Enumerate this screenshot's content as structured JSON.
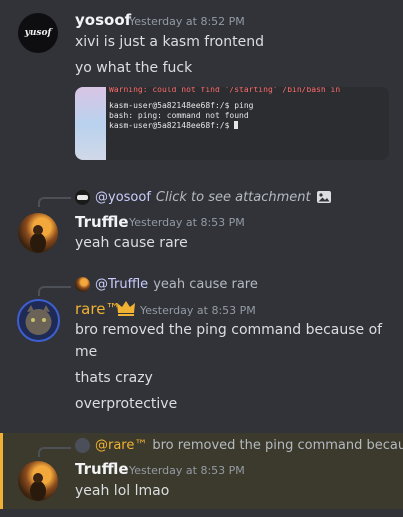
{
  "messages": [
    {
      "author": "yosoof",
      "author_color": "#f2f3f5",
      "timestamp": "Yesterday at 8:52 PM",
      "avatar_text": "yusof",
      "lines": [
        "xivi is just a kasm frontend",
        "yo what the fuck"
      ],
      "attachment": {
        "warning": "Warning: could not find '/starting' /bin/bash  in",
        "terminal_lines": [
          "kasm-user@5a82148ee68f:/$ ping",
          "bash: ping: command not found",
          "kasm-user@5a82148ee68f:/$ "
        ]
      }
    },
    {
      "author": "Truffle",
      "author_color": "#f2f3f5",
      "timestamp": "Yesterday at 8:53 PM",
      "reply": {
        "author": "@yosoof",
        "text": "Click to see attachment",
        "icon": "image-icon"
      },
      "lines": [
        "yeah cause rare"
      ]
    },
    {
      "author": "rare™",
      "author_color": "#f0b232",
      "badge": "crown-icon",
      "timestamp": "Yesterday at 8:53 PM",
      "reply": {
        "author": "@Truffle",
        "text": "yeah cause rare"
      },
      "lines": [
        "bro removed the ping command because of",
        "me",
        "thats crazy",
        "overprotective"
      ]
    },
    {
      "author": "Truffle",
      "author_color": "#f2f3f5",
      "timestamp": "Yesterday at 8:53 PM",
      "reply": {
        "author": "@rare™",
        "text": "bro removed the ping command becau..."
      },
      "lines": [
        "yeah lol lmao"
      ],
      "highlight_color": "#f0b232"
    }
  ]
}
